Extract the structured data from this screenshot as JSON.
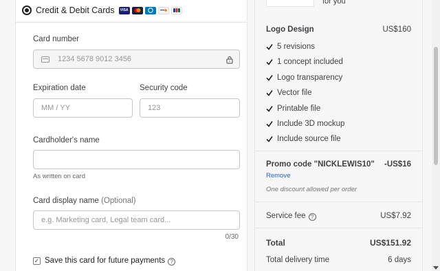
{
  "payment": {
    "method_label": "Credit & Debit Cards",
    "card_brands": [
      "VISA",
      "MC",
      "DC",
      "DISC",
      "JCB"
    ],
    "card_number": {
      "label": "Card number",
      "placeholder": "1234 5678 9012 3456"
    },
    "expiration": {
      "label": "Expiration date",
      "placeholder": "MM / YY"
    },
    "security": {
      "label": "Security code",
      "placeholder": "123"
    },
    "cardholder": {
      "label": "Cardholder's name",
      "value": "",
      "hint": "As written on card"
    },
    "display_name": {
      "label": "Card display name",
      "optional": "(Optional)",
      "placeholder": "e.g. Marketing card, Legal team card...",
      "counter": "0/30"
    },
    "save_card": {
      "label": "Save this card for future payments",
      "checked": true
    }
  },
  "summary": {
    "for_you": "for you",
    "package": {
      "title": "Logo Design",
      "price": "US$160"
    },
    "features": [
      "5 revisions",
      "1 concept included",
      "Logo transparency",
      "Vector file",
      "Printable file",
      "Include 3D mockup",
      "Include source file"
    ],
    "promo": {
      "label": "Promo code \"NICKLEWIS10\"",
      "discount": "-US$16",
      "remove": "Remove",
      "note": "One discount allowed per order"
    },
    "service_fee": {
      "label": "Service fee",
      "value": "US$7.92"
    },
    "total": {
      "label": "Total",
      "value": "US$151.92"
    },
    "delivery": {
      "label": "Total delivery time",
      "value": "6 days"
    }
  },
  "colors": {
    "link": "#1f5ed1",
    "text": "#404145",
    "border": "#c5c6c9"
  }
}
